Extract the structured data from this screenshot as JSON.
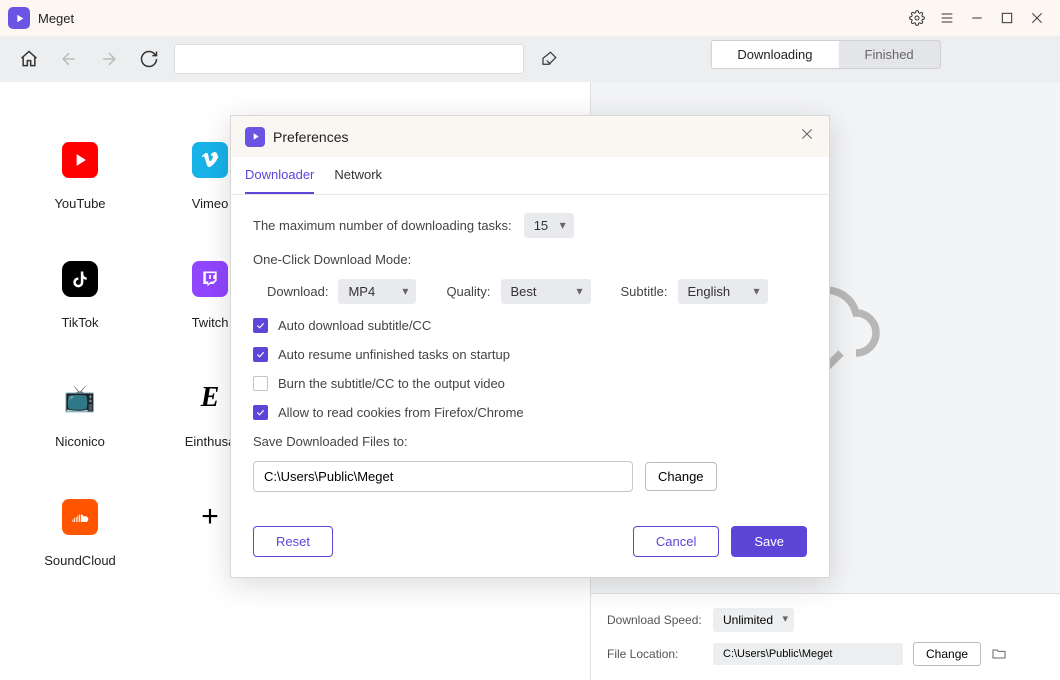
{
  "titlebar": {
    "app_name": "Meget"
  },
  "toolbar": {
    "url_value": ""
  },
  "sites": {
    "youtube": "YouTube",
    "vimeo": "Vimeo",
    "tiktok": "TikTok",
    "twitch": "Twitch",
    "niconico": "Niconico",
    "einthusan": "Einthusa",
    "soundcloud": "SoundCloud"
  },
  "right": {
    "tabs": {
      "downloading": "Downloading",
      "finished": "Finished"
    },
    "footer": {
      "speed_label": "Download Speed:",
      "speed_value": "Unlimited",
      "loc_label": "File Location:",
      "loc_value": "C:\\Users\\Public\\Meget",
      "change": "Change"
    }
  },
  "modal": {
    "title": "Preferences",
    "tabs": {
      "downloader": "Downloader",
      "network": "Network"
    },
    "max_tasks_label": "The maximum number of downloading tasks:",
    "max_tasks_value": "15",
    "oneclick_title": "One-Click Download Mode:",
    "download_label": "Download:",
    "download_value": "MP4",
    "quality_label": "Quality:",
    "quality_value": "Best",
    "subtitle_label": "Subtitle:",
    "subtitle_value": "English",
    "chk_autodl": "Auto download subtitle/CC",
    "chk_resume": "Auto resume unfinished tasks on startup",
    "chk_burn": "Burn the subtitle/CC to the output video",
    "chk_cookies": "Allow to read cookies from Firefox/Chrome",
    "save_label": "Save Downloaded Files to:",
    "save_path": "C:\\Users\\Public\\Meget",
    "change": "Change",
    "reset": "Reset",
    "cancel": "Cancel",
    "save": "Save"
  }
}
